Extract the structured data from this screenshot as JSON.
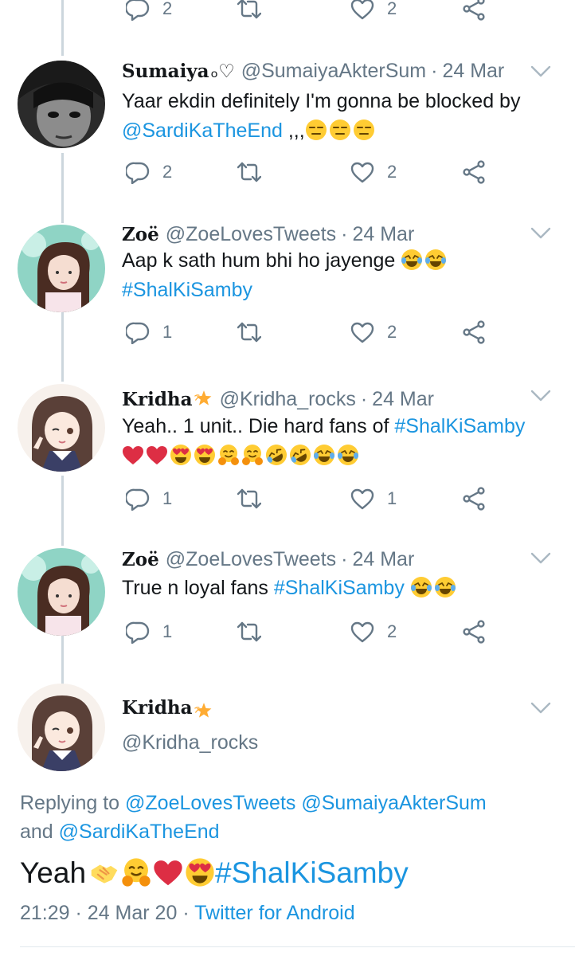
{
  "top_actions": {
    "reply_count": "2",
    "like_count": "2"
  },
  "tweets": [
    {
      "name": "Sumaiya",
      "name_suffix": "ₒ♡",
      "handle": "@SumaiyaAkterSum",
      "sep": "·",
      "date": "24 Mar",
      "text_line1": "Yaar ekdin definitely I'm gonna be blocked by",
      "mention": "@SardiKaTheEnd",
      "text_tail": ",,,",
      "reply_count": "2",
      "like_count": "2"
    },
    {
      "name": "Zoë",
      "handle": "@ZoeLovesTweets",
      "sep": "·",
      "date": "24 Mar",
      "text_line1": "Aap k sath hum bhi ho jayenge",
      "hashtag": "#ShalKiSamby",
      "reply_count": "1",
      "like_count": "2"
    },
    {
      "name": "Kridha",
      "handle": "@Kridha_rocks",
      "sep": "·",
      "date": "24 Mar",
      "text_line1": "Yeah.. 1 unit.. Die hard fans of",
      "hashtag": "#ShalKiSamby",
      "reply_count": "1",
      "like_count": "1"
    },
    {
      "name": "Zoë",
      "handle": "@ZoeLovesTweets",
      "sep": "·",
      "date": "24 Mar",
      "text_line1": "True n loyal fans",
      "hashtag": "#ShalKiSamby",
      "reply_count": "1",
      "like_count": "2"
    }
  ],
  "main_tweet": {
    "name": "Kridha",
    "handle": "@Kridha_rocks",
    "replying_prefix": "Replying to",
    "reply_mention_1": "@ZoeLovesTweets",
    "reply_mention_2": "@SumaiyaAkterSum",
    "reply_and": "and",
    "reply_mention_3": "@SardiKaTheEnd",
    "text": "Yeah",
    "hashtag": "#ShalKiSamby",
    "time": "21:29",
    "date": "24 Mar 20",
    "sep": "·",
    "client": "Twitter for Android"
  },
  "colors": {
    "link": "#1b95e0",
    "muted": "#657786",
    "text": "#14171a",
    "thread_line": "#ccd6dd"
  },
  "icons": [
    "reply-icon",
    "retweet-icon",
    "like-icon",
    "share-icon",
    "chevron-down-icon",
    "star-icon",
    "expressionless-face-emoji",
    "laughing-tears-emoji",
    "red-heart-emoji",
    "heart-eyes-emoji",
    "hugging-face-emoji",
    "rolling-laughing-emoji",
    "handshake-emoji"
  ]
}
